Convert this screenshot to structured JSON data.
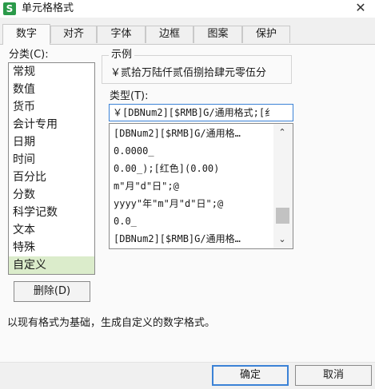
{
  "window": {
    "title": "单元格格式",
    "app_icon": "S",
    "close_glyph": "✕"
  },
  "tabs": [
    {
      "label": "数字",
      "active": true
    },
    {
      "label": "对齐"
    },
    {
      "label": "字体"
    },
    {
      "label": "边框"
    },
    {
      "label": "图案"
    },
    {
      "label": "保护"
    }
  ],
  "category": {
    "label": "分类(C):",
    "items": [
      "常规",
      "数值",
      "货币",
      "会计专用",
      "日期",
      "时间",
      "百分比",
      "分数",
      "科学记数",
      "文本",
      "特殊",
      "自定义"
    ],
    "selected_index": 11
  },
  "delete_button": "删除(D)",
  "sample": {
    "caption": "示例",
    "value": "￥贰拾万陆仟贰佰捌拾肆元零伍分"
  },
  "type": {
    "label": "类型(T):",
    "input_value": "￥[DBNum2][$RMB]G/通用格式;[纟",
    "items": [
      "[DBNum2][$RMB]G/通用格…",
      "0.0000_",
      "0.00_);[红色](0.00)",
      "m\"月\"d\"日\";@",
      "yyyy\"年\"m\"月\"d\"日\";@",
      "0.0_",
      "[DBNum2][$RMB]G/通用格…"
    ]
  },
  "scrollbar": {
    "up_icon": "chevron-up-icon",
    "down_icon": "chevron-down-icon",
    "up_glyph": "⌃",
    "down_glyph": "⌄"
  },
  "description": "以现有格式为基础，生成自定义的数字格式。",
  "buttons": {
    "ok": "确定",
    "cancel": "取消"
  },
  "colors": {
    "selected_bg": "#dbeccb",
    "focus_border": "#3b82d6",
    "app_icon_bg": "#2b9a4a"
  }
}
